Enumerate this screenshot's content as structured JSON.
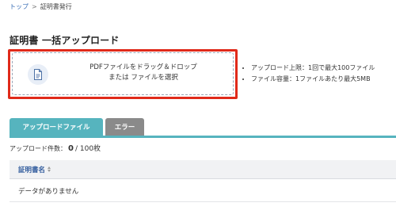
{
  "breadcrumb": {
    "items": [
      "トップ",
      "証明書発行"
    ],
    "separator": ">"
  },
  "page": {
    "title": "証明書 一括アップロード"
  },
  "dropzone": {
    "line1": "PDFファイルをドラッグ＆ドロップ",
    "line2": "または ファイルを選択",
    "icon": "pdf-file-icon"
  },
  "notes": [
    "アップロード上限：1回で最大100ファイル",
    "ファイル容量：1ファイルあたり最大5MB"
  ],
  "tabs": [
    {
      "label": "アップロードファイル",
      "active": true
    },
    {
      "label": "エラー",
      "active": false
    }
  ],
  "upload_count": {
    "label": "アップロード件数：",
    "count": "0",
    "total": " / 100枚"
  },
  "table": {
    "columns": [
      "証明書名"
    ],
    "empty_text": "データがありません"
  },
  "colors": {
    "accent": "#56b4be",
    "highlight": "#e02a1a",
    "link": "#3b6fb6"
  }
}
